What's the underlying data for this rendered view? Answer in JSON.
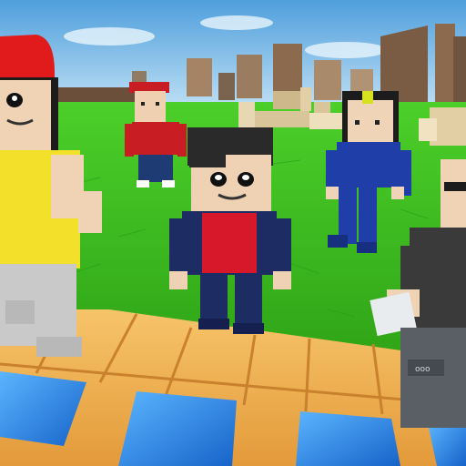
{
  "scene": {
    "type": "blocky 3D game world",
    "colors": {
      "sky_top": "#4f9fdc",
      "sky_bottom": "#c8e6f7",
      "grass": "#3cbd22",
      "grass_dark": "#2a9a17",
      "plank": "#f2b04e",
      "plank_edge": "#c9812d",
      "water": "#1e7fe0",
      "water_light": "#5cb5ff",
      "block_tan": "#d9c59a",
      "tower": "#8c6a4e"
    },
    "characters": [
      {
        "name": "red-cap-character",
        "shirt": "#f2e02a",
        "cap": "#e11b1b"
      },
      {
        "name": "far-red-shirt-character",
        "shirt": "#c81d22",
        "cap": "#c81d22"
      },
      {
        "name": "center-character",
        "shirt": "#d6182a",
        "jacket": "#1d2c63",
        "hair": "#2a2a2a"
      },
      {
        "name": "blue-suit-character",
        "shirt": "#1f3ea8",
        "hair": "#1c1c1c"
      },
      {
        "name": "grey-shirt-character",
        "shirt": "#3a3a3a",
        "pants": "#5a5f66"
      }
    ],
    "badge_text": "ooo"
  }
}
